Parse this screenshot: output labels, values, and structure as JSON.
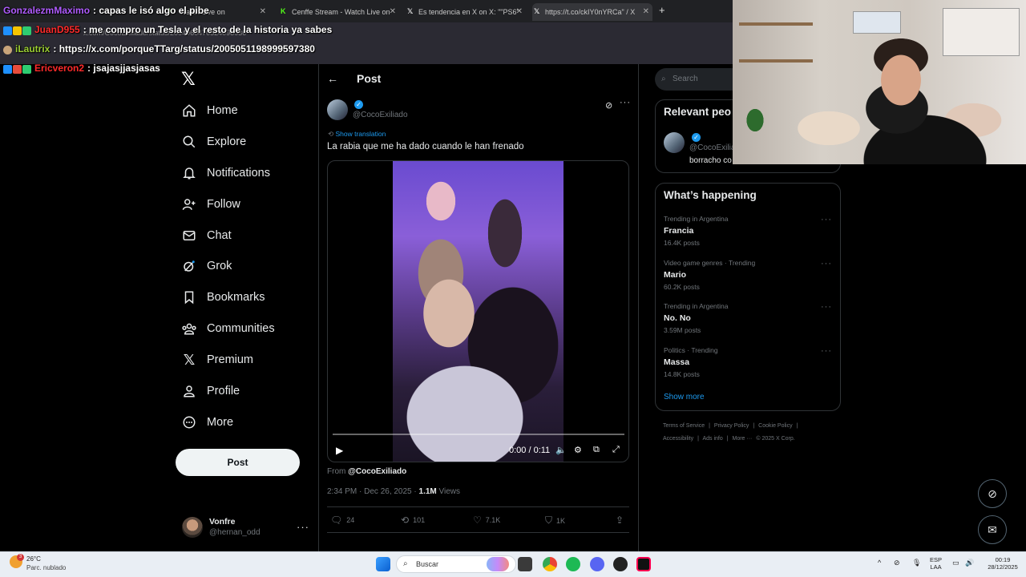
{
  "browser": {
    "tabs": [
      {
        "title": "Watch Live on",
        "icon": "kick-icon"
      },
      {
        "title": "Cenffe Stream - Watch Live on",
        "icon": "kick-icon"
      },
      {
        "title": "Es tendencia en X on X: \"\"PS6\"",
        "icon": "x-icon"
      },
      {
        "title": "https://t.co/ckIY0nYRCa\" / X",
        "icon": "x-icon"
      }
    ],
    "url_fragment": "x.com/CocoExiliado/status/2004960470524098036"
  },
  "chat": [
    {
      "user": "GonzalezmMaximo",
      "sep": ":",
      "message": "capas le isó algo el pibe",
      "color": "#b05cff"
    },
    {
      "user": "JuanD955",
      "sep": ":",
      "message": "me compro un Tesla y el resto de la historia ya sabes",
      "color": "#ff2a2a"
    },
    {
      "user": "iLautrix",
      "sep": ":",
      "message": "https://x.com/porqueTTarg/status/2005051198999597380",
      "color": "#9acd32"
    },
    {
      "user": "Ericveron2",
      "sep": ":",
      "message": "jsajasjjasjasas",
      "color": "#ff2a2a"
    }
  ],
  "nav": {
    "items": [
      {
        "label": "Home",
        "icon": "home-icon"
      },
      {
        "label": "Explore",
        "icon": "search-icon"
      },
      {
        "label": "Notifications",
        "icon": "bell-icon"
      },
      {
        "label": "Follow",
        "icon": "add-person-icon"
      },
      {
        "label": "Chat",
        "icon": "mail-icon"
      },
      {
        "label": "Grok",
        "icon": "grok-icon"
      },
      {
        "label": "Bookmarks",
        "icon": "bookmark-icon"
      },
      {
        "label": "Communities",
        "icon": "communities-icon"
      },
      {
        "label": "Premium",
        "icon": "x-icon"
      },
      {
        "label": "Profile",
        "icon": "person-icon"
      },
      {
        "label": "More",
        "icon": "more-circle-icon"
      }
    ],
    "post_button": "Post",
    "account": {
      "name": "Vonfre",
      "handle": "@hernan_odd"
    }
  },
  "post": {
    "header": "Post",
    "handle": "@CocoExiliado",
    "show_translation": "Show translation",
    "text": "La rabia que me ha dado cuando le han frenado",
    "video": {
      "time": "0:00 / 0:11",
      "progress": 0.0
    },
    "from_label": "From",
    "from_handle": "@CocoExiliado",
    "timestamp": "2:34 PM · Dec 26, 2025 · ",
    "views_count": "1.1M",
    "views_label": " Views",
    "actions": {
      "replies": "24",
      "reposts": "101",
      "likes": "7.1K",
      "bookmarks": "1K"
    }
  },
  "sidebar": {
    "search_placeholder": "Search",
    "relevant_title": "Relevant peo",
    "relevant_handle": "@CocoExilia",
    "relevant_bio": "borracho co",
    "happening_title": "What’s happening",
    "trends": [
      {
        "context": "Trending in Argentina",
        "name": "Francia",
        "posts": "16.4K posts"
      },
      {
        "context": "Video game genres · Trending",
        "name": "Mario",
        "posts": "60.2K posts"
      },
      {
        "context": "Trending in Argentina",
        "name": "No. No",
        "posts": "3.59M posts"
      },
      {
        "context": "Politics · Trending",
        "name": "Massa",
        "posts": "14.8K posts"
      }
    ],
    "show_more": "Show more",
    "footer_row1": [
      "Terms of Service",
      "|",
      "Privacy Policy",
      "|",
      "Cookie Policy",
      "|"
    ],
    "footer_row2": [
      "Accessibility",
      "|",
      "Ads info",
      "|",
      "More ···",
      "© 2025 X Corp."
    ]
  },
  "taskbar": {
    "weather_temp": "26°C",
    "weather_desc": "Parc. nublado",
    "weather_badge": "3",
    "search_label": "Buscar",
    "lang_top": "ESP",
    "lang_bottom": "LAA",
    "time": "00:19",
    "date": "28/12/2025"
  },
  "colors": {
    "accent": "#1d9bf0",
    "background": "#000000",
    "border": "#2f3336",
    "muted_text": "#71767b"
  }
}
